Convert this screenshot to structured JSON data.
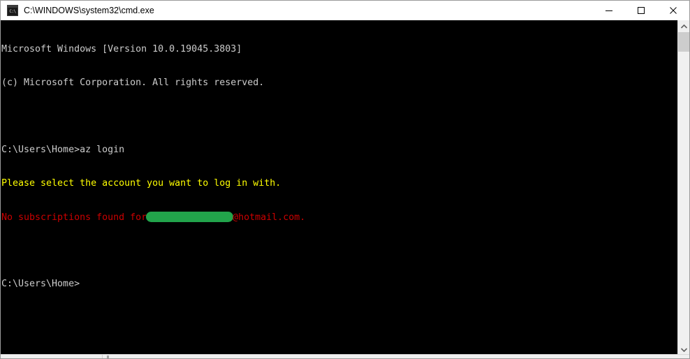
{
  "window": {
    "title": "C:\\WINDOWS\\system32\\cmd.exe",
    "icon": "cmd-console-icon",
    "controls": {
      "minimize_label": "Minimize",
      "maximize_label": "Maximize",
      "close_label": "Close"
    }
  },
  "console": {
    "background_color": "#000000",
    "default_text_color": "#cccccc",
    "lines": [
      {
        "id": "l1",
        "color": "#cccccc",
        "text": "Microsoft Windows [Version 10.0.19045.3803]"
      },
      {
        "id": "l2",
        "color": "#cccccc",
        "text": "(c) Microsoft Corporation. All rights reserved."
      },
      {
        "id": "l3",
        "color": "#cccccc",
        "text": ""
      },
      {
        "id": "l4",
        "color": "#cccccc",
        "text": "C:\\Users\\Home>az login"
      },
      {
        "id": "l5",
        "color": "#ffff00",
        "text": "Please select the account you want to log in with."
      },
      {
        "id": "l6a",
        "color": "#cc0000",
        "text": "No subscriptions found for"
      },
      {
        "id": "l6b",
        "color": "#cc0000",
        "text": "@hotmail.com."
      },
      {
        "id": "l7",
        "color": "#cccccc",
        "text": ""
      },
      {
        "id": "l8",
        "color": "#cccccc",
        "text": "C:\\Users\\Home>"
      }
    ],
    "redaction": {
      "label": "redacted-email-username",
      "color": "#22a44b"
    }
  },
  "scrollbars": {
    "vertical": {
      "up_arrow": "chevron-up-icon",
      "down_arrow": "chevron-down-icon",
      "thumb_color": "#cdcdcd"
    },
    "horizontal": {
      "thumb_color": "#a6a6a6"
    }
  }
}
